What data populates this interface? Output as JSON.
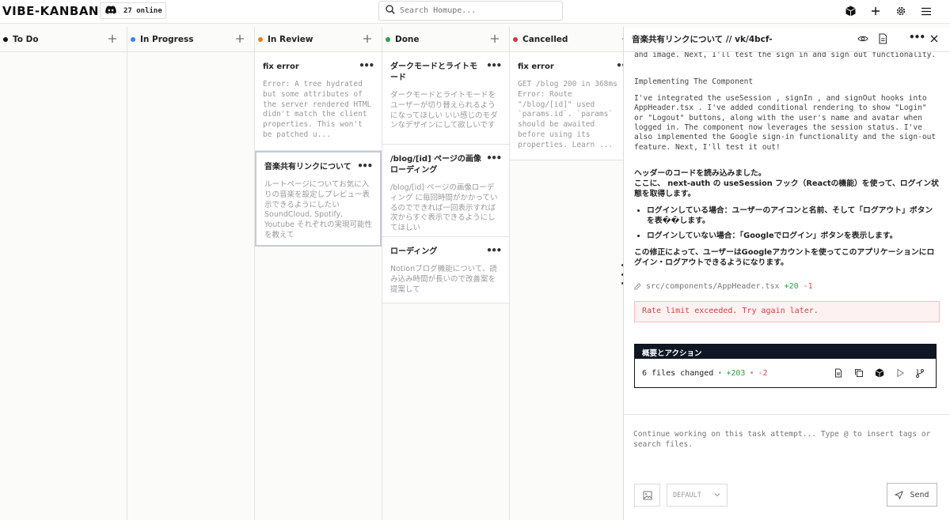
{
  "app": {
    "logo": "VIBE-KANBAN",
    "online_label": "27 online",
    "search_placeholder": "Search Homupe..."
  },
  "columns": [
    {
      "name": "To Do",
      "color": "#111111",
      "cards": []
    },
    {
      "name": "In Progress",
      "color": "#3b82f6",
      "cards": []
    },
    {
      "name": "In Review",
      "color": "#e67e22",
      "cards": [
        {
          "title": "fix error",
          "desc": "Error: A tree hydrated but some attributes of the server rendered HTML didn't match the client properties. This won't be patched u...",
          "selected": false
        },
        {
          "title": "音楽共有リンクについて",
          "desc": "ルートページについてお気に入りの音楽を設定しプレビュー表示できるようにしたい SoundCloud, Spotify, Youtube それぞれの実現可能性を教えて",
          "selected": true
        }
      ]
    },
    {
      "name": "Done",
      "color": "#2f9e44",
      "cards": [
        {
          "title": "ダークモードとライトモード",
          "desc": "ダークモードとライトモードをユーザーが切り替えられるようになってほしい いい感じのモダンなデザインにして欲しいです",
          "selected": false
        },
        {
          "title": "/blog/[id] ページの画像ローディング",
          "desc": "/blog/[id] ページの画像ローディング に毎回時間がかかっているのでできれば一回表示すれば次からすぐ表示できるようにしてほしい",
          "selected": false
        },
        {
          "title": "ローディング",
          "desc": "Notionブログ機能について、読み込み時間が長いので改善案を提案して",
          "selected": false
        }
      ]
    },
    {
      "name": "Cancelled",
      "color": "#e03131",
      "cards": [
        {
          "title": "fix error",
          "desc": "GET /blog 200 in 368ms Error: Route \"/blog/[id]\" used `params.id`. `params` should be awaited before using its properties. Learn ...",
          "selected": false
        }
      ]
    }
  ],
  "panel": {
    "title": "音楽共有リンクについて  //  vk/4bcf-",
    "log_top": "and image. Next, I'll test the sign in and sign out functionality.",
    "section_heading": "Implementing The Component",
    "section_body": "I've integrated the  useSession ,  signIn , and  signOut  hooks into  AppHeader.tsx . I've added conditional rendering to show \"Login\" or \"Logout\" buttons, along with the user's name and avatar when logged in. The component now leverages the session status. I've also implemented the Google sign-in functionality and the sign-out feature. Next, I'll test it out!",
    "jp_intro": "ヘッダーのコードを読み込みました。\nここに、 next-auth  の  useSession  フック（Reactの機能）を使って、ログイン状態を取得します。",
    "bullets": [
      "ログインしている場合：ユーザーのアイコンと名前、そして「ログアウト」ボタンを表��します。",
      "ログインしていない場合：「Googleでログイン」ボタンを表示します。"
    ],
    "jp_outro": "この修正によって、ユーザーはGoogleアカウントを使ってこのアプリケーションにログイン・ログアウトできるようになります。",
    "file_path": "src/components/AppHeader.tsx",
    "file_added": "+20",
    "file_removed": "-1",
    "rate_limit": "Rate limit exceeded. Try again later.",
    "summary_title": "概要とアクション",
    "summary_files": "6 files changed",
    "summary_sep": "•",
    "summary_added": "+203",
    "summary_removed": "-2",
    "chat_placeholder": "Continue working on this task attempt... Type @ to insert tags or search files.",
    "variant": "DEFAULT",
    "send_label": "Send"
  }
}
